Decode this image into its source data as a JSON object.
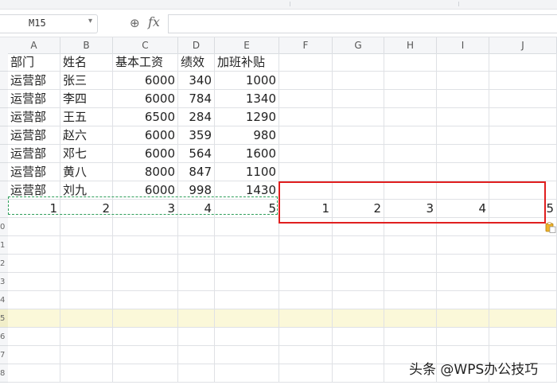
{
  "toolbar": {
    "name_box": "M15",
    "dropdown_arrow": "▾",
    "zoom_icon": "⊕",
    "fx_label": "fx",
    "formula_value": ""
  },
  "columns": [
    "A",
    "B",
    "C",
    "D",
    "E",
    "F",
    "G",
    "H",
    "I",
    "J"
  ],
  "rows": [
    {
      "label": "",
      "cells": [
        "部门",
        "姓名",
        "基本工资",
        "绩效",
        "加班补贴",
        "",
        "",
        "",
        "",
        ""
      ]
    },
    {
      "label": "",
      "cells": [
        "运营部",
        "张三",
        "6000",
        "340",
        "1000",
        "",
        "",
        "",
        "",
        ""
      ]
    },
    {
      "label": "",
      "cells": [
        "运营部",
        "李四",
        "6000",
        "784",
        "1340",
        "",
        "",
        "",
        "",
        ""
      ]
    },
    {
      "label": "",
      "cells": [
        "运营部",
        "王五",
        "6500",
        "284",
        "1290",
        "",
        "",
        "",
        "",
        ""
      ]
    },
    {
      "label": "",
      "cells": [
        "运营部",
        "赵六",
        "6000",
        "359",
        "980",
        "",
        "",
        "",
        "",
        ""
      ]
    },
    {
      "label": "",
      "cells": [
        "运营部",
        "邓七",
        "6000",
        "564",
        "1600",
        "",
        "",
        "",
        "",
        ""
      ]
    },
    {
      "label": "",
      "cells": [
        "运营部",
        "黄八",
        "8000",
        "847",
        "1100",
        "",
        "",
        "",
        "",
        ""
      ]
    },
    {
      "label": "",
      "cells": [
        "运营部",
        "刘九",
        "6000",
        "998",
        "1430",
        "",
        "",
        "",
        "",
        ""
      ]
    },
    {
      "label": "",
      "cells": [
        "1",
        "2",
        "3",
        "4",
        "5",
        "1",
        "2",
        "3",
        "4",
        "5"
      ]
    },
    {
      "label": "0",
      "cells": [
        "",
        "",
        "",
        "",
        "",
        "",
        "",
        "",
        "",
        ""
      ]
    },
    {
      "label": "1",
      "cells": [
        "",
        "",
        "",
        "",
        "",
        "",
        "",
        "",
        "",
        ""
      ]
    },
    {
      "label": "2",
      "cells": [
        "",
        "",
        "",
        "",
        "",
        "",
        "",
        "",
        "",
        ""
      ]
    },
    {
      "label": "3",
      "cells": [
        "",
        "",
        "",
        "",
        "",
        "",
        "",
        "",
        "",
        ""
      ]
    },
    {
      "label": "4",
      "cells": [
        "",
        "",
        "",
        "",
        "",
        "",
        "",
        "",
        "",
        ""
      ]
    },
    {
      "label": "5",
      "cells": [
        "",
        "",
        "",
        "",
        "",
        "",
        "",
        "",
        "",
        ""
      ]
    },
    {
      "label": "6",
      "cells": [
        "",
        "",
        "",
        "",
        "",
        "",
        "",
        "",
        "",
        ""
      ]
    },
    {
      "label": "7",
      "cells": [
        "",
        "",
        "",
        "",
        "",
        "",
        "",
        "",
        "",
        ""
      ]
    },
    {
      "label": "8",
      "cells": [
        "",
        "",
        "",
        "",
        "",
        "",
        "",
        "",
        "",
        ""
      ]
    }
  ],
  "highlight_row_label": "5",
  "colors": {
    "copy_marquee": "#2e9e5a",
    "annotation_box": "#e01f1f",
    "row_highlight": "#fbf8d9"
  },
  "watermark": "头条 @WPS办公技巧"
}
